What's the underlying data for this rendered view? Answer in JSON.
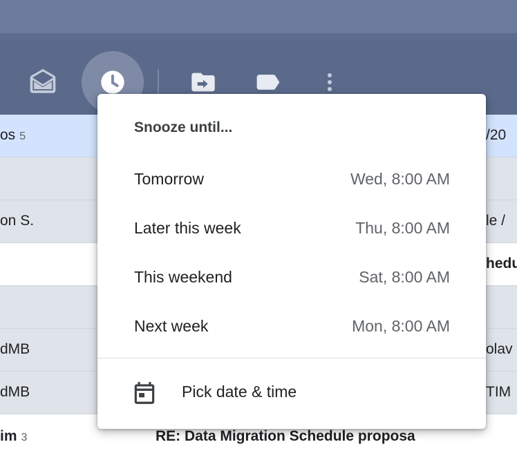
{
  "rows": [
    {
      "sender": "os",
      "count": "5",
      "subject": "/20",
      "bg": "#d3e3fd",
      "bold": false
    },
    {
      "sender": "",
      "count": "",
      "subject": "",
      "bg": "#dfe3ea",
      "bold": false
    },
    {
      "sender": "on S.",
      "count": "",
      "subject": "le /",
      "bg": "#dfe3ea",
      "bold": false
    },
    {
      "sender": "",
      "count": "",
      "subject": "hedu",
      "bg": "#ffffff",
      "bold": true
    },
    {
      "sender": "",
      "count": "",
      "subject": "",
      "bg": "#dfe3ea",
      "bold": false
    },
    {
      "sender": "dMB",
      "count": "",
      "subject": "olav",
      "bg": "#dfe3ea",
      "bold": false
    },
    {
      "sender": "dMB",
      "count": "",
      "subject": "TIM",
      "bg": "#dfe3ea",
      "bold": false
    }
  ],
  "bottom_row": {
    "sender": "im",
    "count": "3",
    "subject": "RE: Data Migration Schedule proposa"
  },
  "snooze_menu": {
    "title": "Snooze until...",
    "options": [
      {
        "label": "Tomorrow",
        "time": "Wed, 8:00 AM"
      },
      {
        "label": "Later this week",
        "time": "Thu, 8:00 AM"
      },
      {
        "label": "This weekend",
        "time": "Sat, 8:00 AM"
      },
      {
        "label": "Next week",
        "time": "Mon, 8:00 AM"
      }
    ],
    "pick_label": "Pick date & time"
  },
  "toolbar": {
    "icons": [
      "mark-as-read-icon",
      "snooze-icon",
      "move-to-icon",
      "label-icon",
      "more-vert-icon"
    ]
  },
  "colors": {
    "toolbar_bg": "#5b6a8b",
    "snooze_active_bg": "#7e8aa6",
    "unread_row_bg": "#ffffff",
    "read_row_bg": "#dfe3ea",
    "selected_row_bg": "#d3e3fd"
  }
}
